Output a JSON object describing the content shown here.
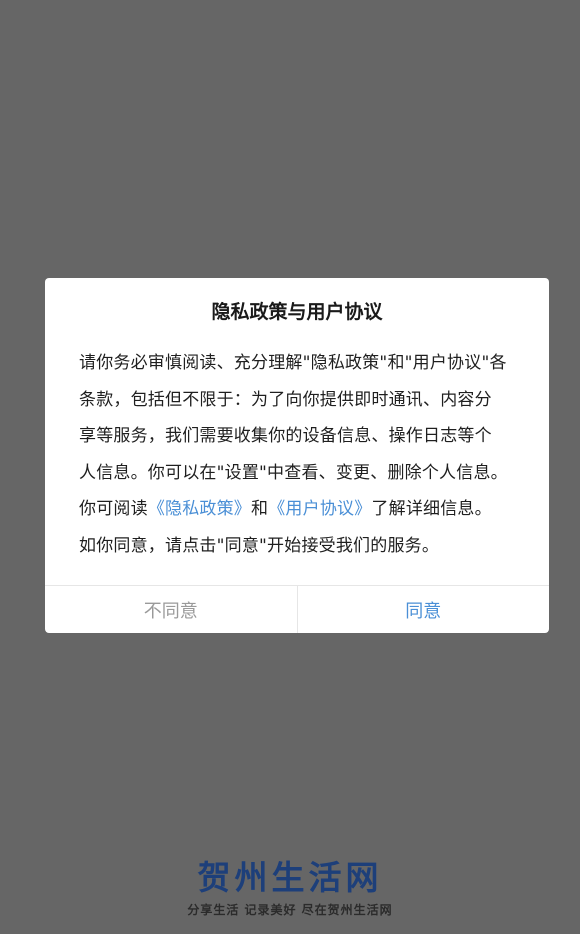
{
  "dialog": {
    "title": "隐私政策与用户协议",
    "body": {
      "lines": [
        "请你务必审慎阅读、充分理解\"隐私政策\"和\"用户协议\"各",
        "条款，包括但不限于：为了向你提供即时通讯、内容分",
        "享等服务，我们需要收集你的设备信息、操作日志等个",
        "人信息。你可以在\"设置\"中查看、变更、删除个人信息。"
      ],
      "read_prefix": "你可阅读",
      "privacy_link": "《隐私政策》",
      "and_text": "和",
      "agreement_link": "《用户协议》",
      "read_suffix": "了解详细信息。",
      "last_line": "如你同意，请点击\"同意\"开始接受我们的服务。"
    },
    "buttons": {
      "disagree": "不同意",
      "agree": "同意"
    }
  },
  "brand": {
    "name": "贺州生活网",
    "slogan": "分享生活  记录美好  尽在贺州生活网"
  },
  "colors": {
    "overlay": "#666666",
    "link": "#4a8fd6",
    "brand": "#1d3f7a"
  }
}
